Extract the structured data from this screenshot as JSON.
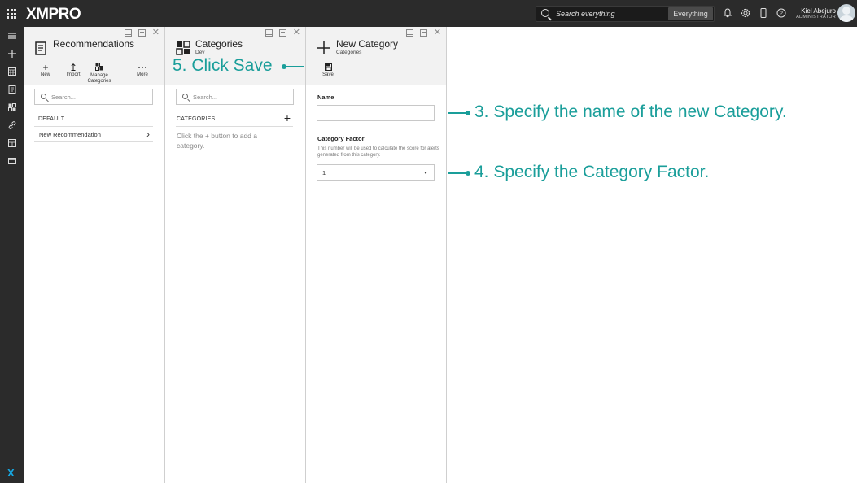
{
  "app": {
    "logo": "XMPRO",
    "search_placeholder": "Search everything",
    "search_scope": "Everything",
    "user_name": "Kiel Abejuro",
    "user_role": "ADMINISTRATOR"
  },
  "panels": {
    "recommendations": {
      "title": "Recommendations",
      "toolbar": {
        "new": "New",
        "import": "Import",
        "manage": "Manage Categories",
        "more": "More"
      },
      "search_placeholder": "Search...",
      "section": "DEFAULT",
      "items": [
        "New Recommendation"
      ]
    },
    "categories": {
      "title": "Categories",
      "subtitle": "Dev",
      "search_placeholder": "Search...",
      "section": "CATEGORIES",
      "empty_text": "Click the + button to add a category."
    },
    "new_category": {
      "title": "New Category",
      "subtitle": "Categories",
      "save_label": "Save",
      "name_label": "Name",
      "name_value": "",
      "factor_label": "Category Factor",
      "factor_help": "This number will be used to calculate the score for alerts generated from this category.",
      "factor_value": "1"
    }
  },
  "annotations": {
    "save": "5. Click Save",
    "name": "3. Specify the name of the new Category.",
    "factor": "4. Specify the Category Factor."
  },
  "colors": {
    "topbar": "#2b2b2b",
    "annotation": "#1a9e9a",
    "panel_header": "#f2f2f2"
  }
}
